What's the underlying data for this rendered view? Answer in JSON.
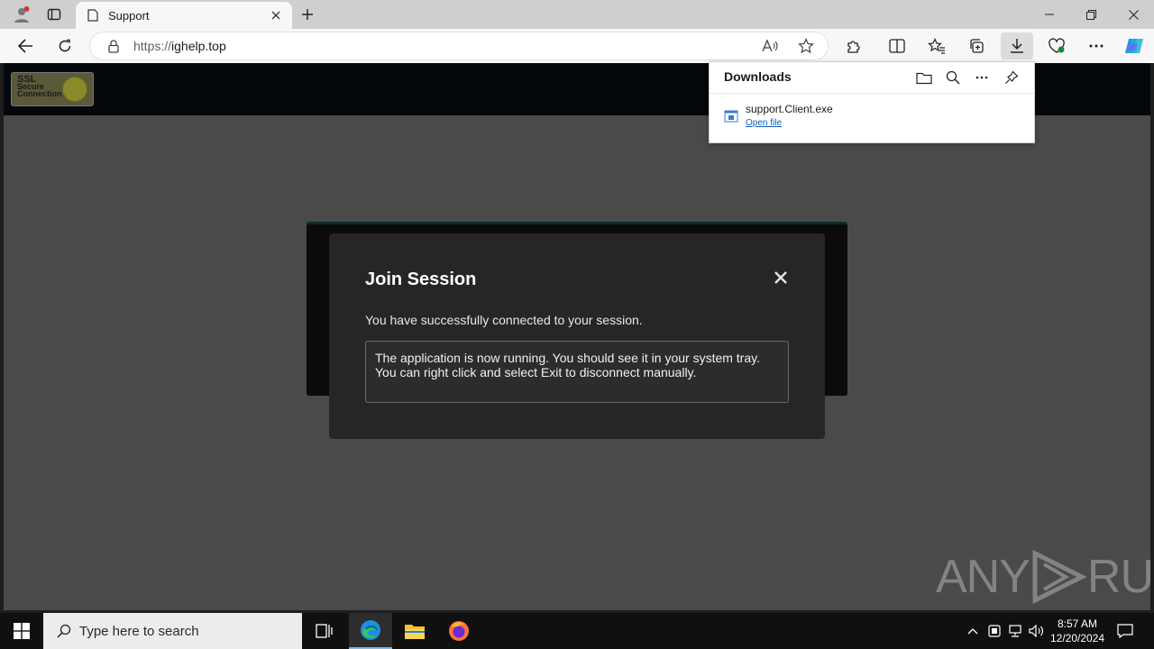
{
  "browser": {
    "tab_title": "Support",
    "url_scheme": "https://",
    "url_host": "ighelp.top",
    "new_tab_label": "+"
  },
  "page": {
    "ssl_line1": "SSL",
    "ssl_line2": "Secure",
    "ssl_line3": "Connection",
    "modal": {
      "title": "Join Session",
      "message": "You have successfully connected to your session.",
      "info_line1": "The application is now running. You should see it in your system tray.",
      "info_line2": "You can right click and select Exit to disconnect manually."
    },
    "watermark_left": "ANY",
    "watermark_right": "RUN"
  },
  "downloads": {
    "title": "Downloads",
    "file_name": "support.Client.exe",
    "open_link": "Open file"
  },
  "taskbar": {
    "search_placeholder": "Type here to search",
    "time": "8:57 AM",
    "date": "12/20/2024"
  },
  "colors": {
    "accent": "#0f5fb8",
    "page_bg": "#4a4a4a",
    "modal_bg": "#262626",
    "header_bg": "#04080c"
  }
}
